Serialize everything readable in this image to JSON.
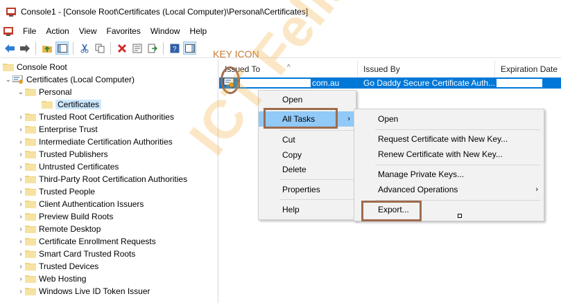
{
  "window": {
    "title": "Console1 - [Console Root\\Certificates (Local Computer)\\Personal\\Certificates]"
  },
  "menubar": {
    "items": [
      "File",
      "Action",
      "View",
      "Favorites",
      "Window",
      "Help"
    ]
  },
  "toolbar": {
    "icons": [
      "back-arrow-icon",
      "forward-arrow-icon",
      "up-folder-icon",
      "show-hide-tree-icon",
      "cut-icon",
      "copy-icon",
      "delete-icon",
      "properties-icon",
      "export-list-icon",
      "help-icon",
      "show-action-pane-icon"
    ]
  },
  "tree": {
    "root": "Console Root",
    "computer": "Certificates (Local Computer)",
    "personal": "Personal",
    "selected": "Certificates",
    "stores": [
      "Trusted Root Certification Authorities",
      "Enterprise Trust",
      "Intermediate Certification Authorities",
      "Trusted Publishers",
      "Untrusted Certificates",
      "Third-Party Root Certification Authorities",
      "Trusted People",
      "Client Authentication Issuers",
      "Preview Build Roots",
      "Remote Desktop",
      "Certificate Enrollment Requests",
      "Smart Card Trusted Roots",
      "Trusted Devices",
      "Web Hosting",
      "Windows Live ID Token Issuer"
    ]
  },
  "list": {
    "columns": [
      "Issued To",
      "Issued By",
      "Expiration Date"
    ],
    "row": {
      "issued_to_suffix": "com.au",
      "issued_by": "Go Daddy Secure Certificate Auth..."
    }
  },
  "context_menu": {
    "items": [
      "Open",
      "All Tasks",
      "Cut",
      "Copy",
      "Delete",
      "Properties",
      "Help"
    ]
  },
  "submenu": {
    "items": [
      "Open",
      "Request Certificate with New Key...",
      "Renew Certificate with New Key...",
      "Manage Private Keys...",
      "Advanced Operations",
      "Export..."
    ]
  },
  "annotations": {
    "key_icon_label": "KEY ICON",
    "watermark": "ICT Fella"
  },
  "colors": {
    "selection": "#0078d7",
    "menu_hot": "#91c9f7",
    "highlight_box": "#9e6b4d",
    "watermark": "#f3b043"
  }
}
